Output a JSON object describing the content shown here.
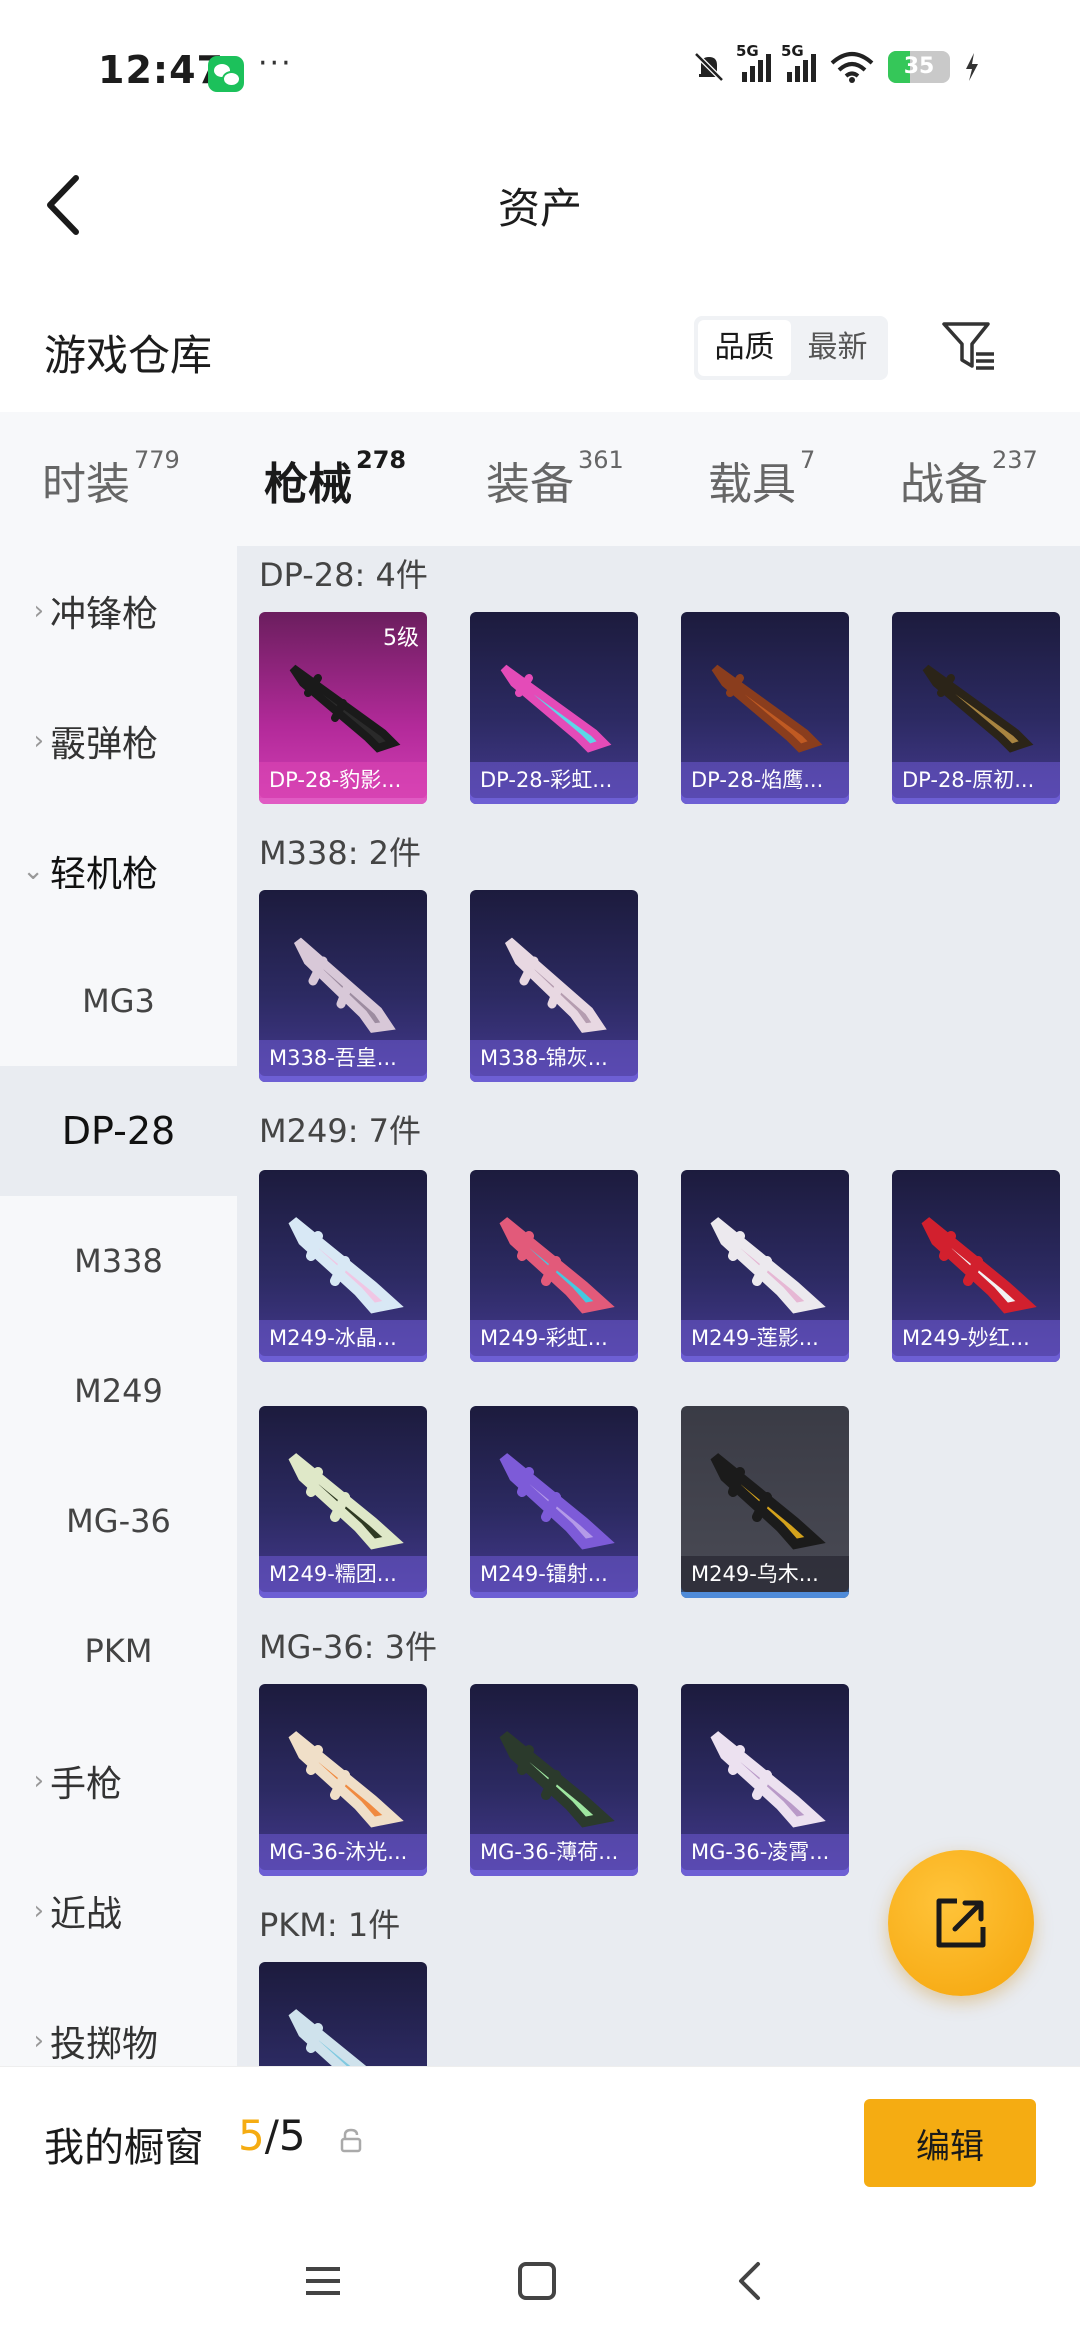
{
  "status_bar": {
    "time": "12:47",
    "dots": "···",
    "battery": "35",
    "network": "5G"
  },
  "header": {
    "title": "资产"
  },
  "warehouse": {
    "title": "游戏仓库",
    "sort_quality": "品质",
    "sort_latest": "最新"
  },
  "tabs": [
    {
      "label": "时装",
      "count": "779"
    },
    {
      "label": "枪械",
      "count": "278"
    },
    {
      "label": "装备",
      "count": "361"
    },
    {
      "label": "载具",
      "count": "7"
    },
    {
      "label": "战备",
      "count": "237"
    }
  ],
  "sidebar": {
    "cat_smg": "冲锋枪",
    "cat_shotgun": "霰弹枪",
    "cat_lmg": "轻机枪",
    "sub_mg3": "MG3",
    "sub_dp28": "DP-28",
    "sub_m338": "M338",
    "sub_m249": "M249",
    "sub_mg36": "MG-36",
    "sub_pkm": "PKM",
    "cat_pistol": "手枪",
    "cat_melee": "近战",
    "cat_throw": "投掷物"
  },
  "groups": [
    {
      "title": "DP-28: 4件",
      "items": [
        {
          "name": "DP-28-豹影...",
          "level": "5级"
        },
        {
          "name": "DP-28-彩虹..."
        },
        {
          "name": "DP-28-焰鹰..."
        },
        {
          "name": "DP-28-原初..."
        }
      ]
    },
    {
      "title": "M338: 2件",
      "items": [
        {
          "name": "M338-吾皇..."
        },
        {
          "name": "M338-锦灰..."
        }
      ]
    },
    {
      "title": "M249: 7件",
      "items": [
        {
          "name": "M249-冰晶..."
        },
        {
          "name": "M249-彩虹..."
        },
        {
          "name": "M249-莲影..."
        },
        {
          "name": "M249-妙红..."
        },
        {
          "name": "M249-糯团..."
        },
        {
          "name": "M249-镭射..."
        },
        {
          "name": "M249-乌木..."
        }
      ]
    },
    {
      "title": "MG-36: 3件",
      "items": [
        {
          "name": "MG-36-沐光..."
        },
        {
          "name": "MG-36-薄荷..."
        },
        {
          "name": "MG-36-凌霄..."
        }
      ]
    },
    {
      "title": "PKM: 1件",
      "items": []
    }
  ],
  "showcase": {
    "label": "我的橱窗",
    "current": "5",
    "sep_total": "/5",
    "edit_label": "编辑"
  },
  "colors": {
    "accent": "#f5ac12",
    "selected_bg": "#e9ecf1"
  }
}
